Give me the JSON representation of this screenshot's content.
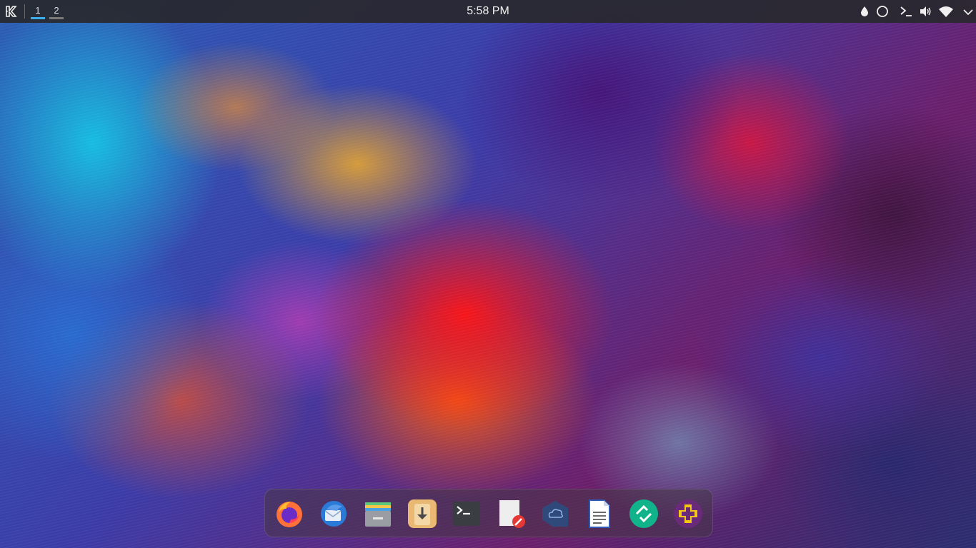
{
  "top_panel": {
    "launcher_icon": "kde-logo-icon",
    "desktops": [
      {
        "label": "1",
        "active": true
      },
      {
        "label": "2",
        "active": false
      }
    ],
    "clock": "5:58 PM",
    "tray": [
      "color-picker-icon",
      "shape-circle-icon",
      "terminal-icon",
      "volume-icon",
      "wifi-icon"
    ]
  },
  "dock": {
    "items": [
      {
        "name": "firefox",
        "icon": "firefox-icon"
      },
      {
        "name": "thunderbird",
        "icon": "thunderbird-icon"
      },
      {
        "name": "archive-manager",
        "icon": "archive-icon"
      },
      {
        "name": "downloader",
        "icon": "download-icon"
      },
      {
        "name": "terminal",
        "icon": "terminal-icon"
      },
      {
        "name": "text-editor",
        "icon": "text-editor-icon"
      },
      {
        "name": "cloud-storage",
        "icon": "cloud-icon"
      },
      {
        "name": "document-viewer",
        "icon": "document-icon"
      },
      {
        "name": "sync-app",
        "icon": "sync-icon"
      },
      {
        "name": "add-app",
        "icon": "plus-icon"
      }
    ]
  },
  "colors": {
    "panel_bg": "#28282c",
    "active_desktop": "#3daee9"
  }
}
